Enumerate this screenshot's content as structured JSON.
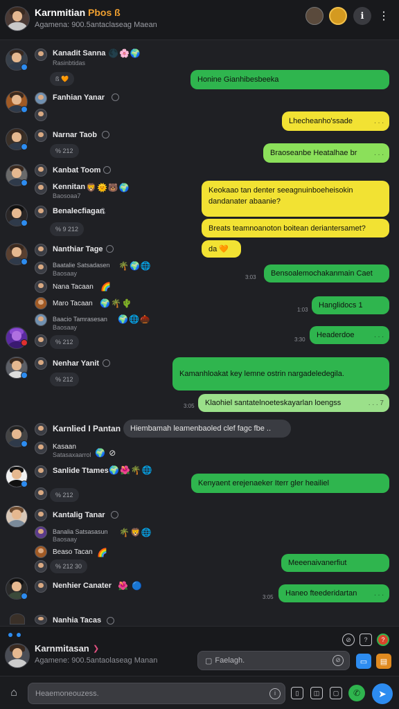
{
  "header": {
    "title": "Karnmitian",
    "title_accent": "Pbos ß",
    "subtitle": "Agamena: 900.5antaclaseag Maean"
  },
  "left_column": [
    {
      "name": "Kanadit Sanna",
      "sub": "Rasinbtidas",
      "stats": "",
      "emoji": "🌑🌸🌍"
    },
    {
      "name": "",
      "sub": "",
      "stats": "ß 🧡",
      "emoji": ""
    },
    {
      "name": "Fanhian Yanar",
      "sub": "",
      "stats": "",
      "emoji": ""
    },
    {
      "name": "Narnar Taob",
      "sub": "",
      "stats": "% 212",
      "emoji": ""
    },
    {
      "name": "Kanbat Toom",
      "sub": "",
      "stats": "",
      "emoji": ""
    },
    {
      "name": "Kennitan",
      "sub": "Baosoaa7",
      "stats": "",
      "emoji": "🦁🌞🐻🌍"
    },
    {
      "name": "Benalecfiagan",
      "sub": "",
      "stats": "% 9 212",
      "emoji": "ß"
    },
    {
      "name": "Nanthiar Tage",
      "sub": "",
      "stats": "",
      "emoji": ""
    },
    {
      "name": "Baatalie Satsadasen",
      "sub": "Baosaay",
      "stats": "",
      "emoji": "🌴🌍🌐"
    },
    {
      "name": "Nana Tacaan",
      "sub": "",
      "stats": "",
      "emoji": "🌈"
    },
    {
      "name": "Maro Tacaan",
      "sub": "",
      "stats": "",
      "emoji": "🌍🌴🌵"
    },
    {
      "name": "Baacio Tamrasesan",
      "sub": "Baosaay",
      "stats": "",
      "emoji": "🌍🌐🌰"
    },
    {
      "name": "",
      "sub": "",
      "stats": "% 212",
      "emoji": ""
    },
    {
      "name": "Nenhar Yanit",
      "sub": "",
      "stats": "% 212",
      "emoji": ""
    },
    {
      "name": "Karnlied I Pantan",
      "sub": "",
      "stats": "",
      "emoji": ""
    },
    {
      "name": "Kasaan",
      "sub": "Satasaxaarrol",
      "stats": "",
      "emoji": "🌍 ⊘"
    },
    {
      "name": "Sanlide Ttames",
      "sub": "",
      "stats": "",
      "emoji": "🌍🌺🌴🌐"
    },
    {
      "name": "",
      "sub": "",
      "stats": "% 212",
      "emoji": ""
    },
    {
      "name": "Kantalig Tanar",
      "sub": "",
      "stats": "",
      "emoji": ""
    },
    {
      "name": "Banalia Satsasasun",
      "sub": "Baosaay",
      "stats": "",
      "emoji": "🌴🦁🌐"
    },
    {
      "name": "Beaso Tacan",
      "sub": "",
      "stats": "",
      "emoji": "🌈"
    },
    {
      "name": "",
      "sub": "",
      "stats": "% 212 30",
      "emoji": ""
    },
    {
      "name": "Nenhier Canater",
      "sub": "",
      "stats": "",
      "emoji": "🌺 🔵"
    },
    {
      "name": "Nanhia Tacas",
      "sub": "",
      "stats": "",
      "emoji": ""
    }
  ],
  "bubbles": [
    {
      "text": "Honine                 Gianhibesbeeka",
      "time": ""
    },
    {
      "text": "Lhecheanho'ssade",
      "time": ""
    },
    {
      "text": "Braoseanbe Heatalhae br",
      "time": ""
    },
    {
      "text": "Keokaao tan denter seeagnuinboeheisokin",
      "time": ""
    },
    {
      "text": "dandanater abaanie?",
      "time": ""
    },
    {
      "text": "Breats teamnoanoton boitean deriantersamet?",
      "time": ""
    },
    {
      "text": "da 🧡",
      "time": ""
    },
    {
      "text": "Bensoalemochakanmain Caet",
      "time": "3:03"
    },
    {
      "text": "Hanglidocs 1",
      "time": "1:03"
    },
    {
      "text": "Headerdoe",
      "time": "3:30"
    },
    {
      "text": "Kamanhloakat key lemne ostrin nargadeledegila.",
      "time": ""
    },
    {
      "text": "Klaohiel santatelnoeteskayarlan loengss",
      "time": "3:05"
    },
    {
      "text": "Hiembamah leamenbaoled clef fagc fbe ..",
      "time": ""
    },
    {
      "text": "Kenyaent erejenaeker Iterr gler heailiel",
      "time": ""
    },
    {
      "text": "Meeenaivanerfiut",
      "time": ""
    },
    {
      "text": "Haneo fteederidartan",
      "time": "3:05"
    }
  ],
  "footer": {
    "name": "Karnmitasan",
    "sub": "Agamene: 900.5antaolaseag Manan",
    "search_value": "Faelagh."
  },
  "composer": {
    "placeholder": "Heaemoneouzess."
  },
  "colors": {
    "bubble_green": "#2fb54e",
    "bubble_lightgreen": "#8be05a",
    "bubble_yellow": "#f2e233",
    "accent_orange": "#f0a030",
    "send_blue": "#2d8cf0"
  }
}
